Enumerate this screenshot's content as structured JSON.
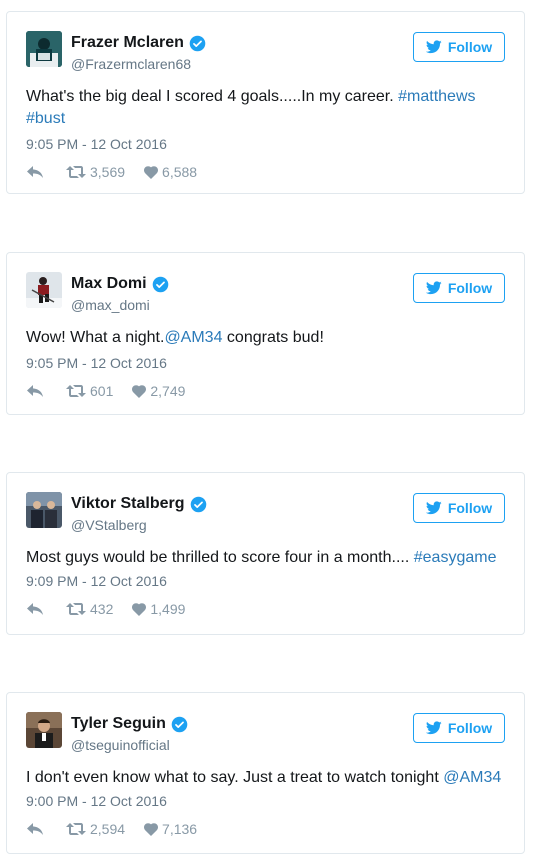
{
  "tweets": [
    {
      "name": "Frazer Mclaren",
      "handle": "@Frazermclaren68",
      "follow_label": "Follow",
      "text_plain": "What's the big deal I scored 4 goals.....In my career. ",
      "text_link1": "#matthews",
      "text_link2": "#bust",
      "time": "9:05 PM - 12 Oct 2016",
      "retweets": "3,569",
      "likes": "6,588"
    },
    {
      "name": "Max Domi",
      "handle": "@max_domi",
      "follow_label": "Follow",
      "text_plain": "Wow! What a night.",
      "text_link1": "@AM34",
      "text_plain2": " congrats bud!",
      "time": "9:05 PM - 12 Oct 2016",
      "retweets": "601",
      "likes": "2,749"
    },
    {
      "name": "Viktor Stalberg",
      "handle": "@VStalberg",
      "follow_label": "Follow",
      "text_plain": "Most guys would be thrilled to score four in a month.... ",
      "text_link1": "#easygame",
      "time": "9:09 PM - 12 Oct 2016",
      "retweets": "432",
      "likes": "1,499"
    },
    {
      "name": "Tyler Seguin",
      "handle": "@tseguinofficial",
      "follow_label": "Follow",
      "text_plain": "I don't even know what to say. Just a treat to watch tonight ",
      "text_link1": "@AM34",
      "time": "9:00 PM - 12 Oct 2016",
      "retweets": "2,594",
      "likes": "7,136"
    }
  ],
  "colors": {
    "twitter_blue": "#1da1f2",
    "link": "#2b7bb9",
    "muted": "#657786",
    "border": "#e1e8ed"
  }
}
